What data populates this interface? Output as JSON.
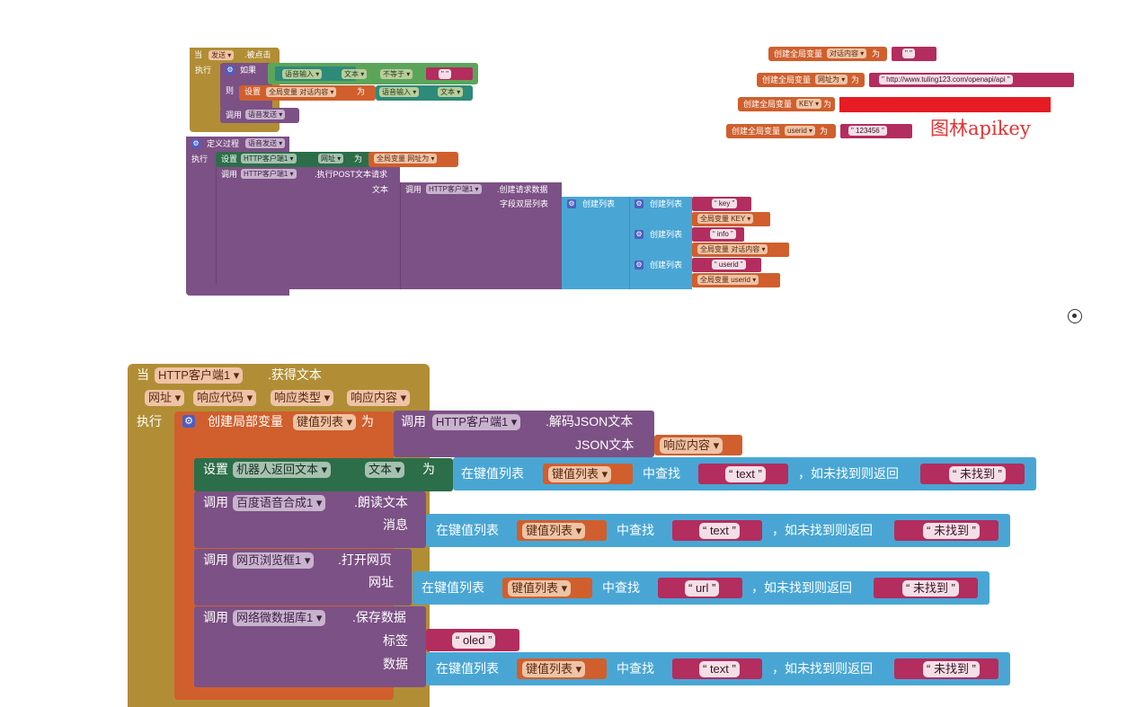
{
  "top_left": {
    "event": {
      "when": "当",
      "component": "发送",
      "event": ".被点击",
      "do": "执行"
    },
    "if_block": {
      "if": "如果",
      "left_component": "语音输入",
      "left_prop": "文本",
      "op": "不等于",
      "empty": "\" \""
    },
    "then": "则",
    "set": {
      "set": "设置",
      "var": "全局变量 对话内容",
      "to": "为",
      "component": "语音输入",
      "prop": "文本"
    },
    "call": {
      "call": "调用",
      "proc": "语音发送"
    },
    "proc_def": {
      "label": "定义过程",
      "name": "语音发送",
      "do": "执行"
    },
    "set_url": {
      "set": "设置",
      "component": "HTTP客户端1",
      "prop": "网址",
      "to": "为",
      "var": "全局变量 网址为"
    },
    "post": {
      "call": "调用",
      "component": "HTTP客户端1",
      "method": ".执行POST文本请求",
      "arg": "文本"
    },
    "build": {
      "call": "调用",
      "component": "HTTP客户端1",
      "method": ".创建请求数据",
      "arg": "字段双层列表"
    },
    "list": "创建列表",
    "pairs": [
      {
        "key": "key",
        "var": "全局变量 KEY"
      },
      {
        "key": "info",
        "var": "全局变量 对话内容"
      },
      {
        "key": "userid",
        "var": "全局变量 userid"
      }
    ]
  },
  "globals": {
    "label": "创建全局变量",
    "to": "为",
    "items": [
      {
        "name": "对话内容",
        "value": "\" \""
      },
      {
        "name": "网址为",
        "value": "\" http://www.tuling123.com/openapi/api \""
      },
      {
        "name": "KEY",
        "value": ""
      },
      {
        "name": "userid",
        "value": "\" 123456 \""
      }
    ],
    "annotation": "图林apikey"
  },
  "bottom": {
    "event": {
      "when": "当",
      "component": "HTTP客户端1",
      "event": ".获得文本",
      "do": "执行"
    },
    "params": [
      "网址",
      "响应代码",
      "响应类型",
      "响应内容"
    ],
    "local": {
      "label": "创建局部变量",
      "name": "键值列表",
      "to": "为",
      "call": "调用",
      "component": "HTTP客户端1",
      "method": ".解码JSON文本",
      "arg": "JSON文本",
      "arg_value": "响应内容"
    },
    "set": {
      "set": "设置",
      "component": "机器人返回文本",
      "prop": "文本",
      "to": "为"
    },
    "lookup": {
      "in": "在键值列表",
      "var": "键值列表",
      "find": "中查找",
      "else": "，如未找到则返回",
      "notfound": "未找到"
    },
    "keys": {
      "text": "text",
      "url": "url",
      "oled": "oled"
    },
    "tts": {
      "call": "调用",
      "component": "百度语音合成1",
      "method": ".朗读文本",
      "arg": "消息"
    },
    "web": {
      "call": "调用",
      "component": "网页浏览框1",
      "method": ".打开网页",
      "arg": "网址"
    },
    "db": {
      "call": "调用",
      "component": "网络微数据库1",
      "method": ".保存数据",
      "arg1": "标签",
      "arg2": "数据"
    }
  },
  "colors": {
    "event": "#b18e35",
    "procedure": "#7c5185",
    "variable": "#d05f2d",
    "list": "#49a6d4",
    "text": "#b32d5e",
    "logic": "#5ba55b",
    "annotation": "#e33333"
  }
}
